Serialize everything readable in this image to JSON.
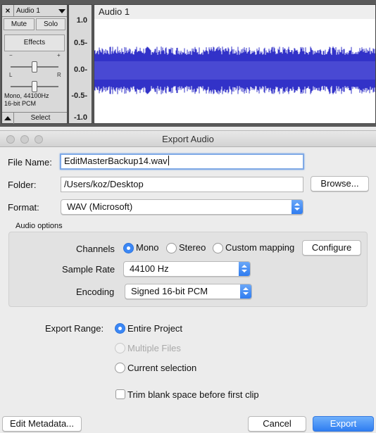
{
  "track": {
    "name": "Audio 1",
    "close_glyph": "×",
    "mute_label": "Mute",
    "solo_label": "Solo",
    "effects_label": "Effects",
    "gain_minus": "−",
    "gain_plus": "+",
    "pan_left": "L",
    "pan_right": "R",
    "info_line1": "Mono, 44100Hz",
    "info_line2": "16-bit PCM",
    "select_label": "Select",
    "waveform_title": "Audio 1",
    "ruler_labels": [
      "1.0",
      "0.5-",
      "0.0-",
      "-0.5-",
      "-1.0"
    ],
    "wave_color": "#3232c8"
  },
  "dialog": {
    "title": "Export Audio",
    "file_name_label": "File Name:",
    "file_name_value": "EditMasterBackup14.wav",
    "folder_label": "Folder:",
    "folder_value": "/Users/koz/Desktop",
    "browse_label": "Browse...",
    "format_label": "Format:",
    "format_value": "WAV (Microsoft)",
    "audio_options_label": "Audio options",
    "channels_label": "Channels",
    "channel_mono": "Mono",
    "channel_stereo": "Stereo",
    "channel_custom": "Custom mapping",
    "configure_label": "Configure",
    "sample_rate_label": "Sample Rate",
    "sample_rate_value": "44100 Hz",
    "encoding_label": "Encoding",
    "encoding_value": "Signed 16-bit PCM",
    "export_range_label": "Export Range:",
    "range_entire": "Entire Project",
    "range_multiple": "Multiple Files",
    "range_current": "Current selection",
    "trim_label": "Trim blank space before first clip",
    "edit_metadata_label": "Edit Metadata...",
    "cancel_label": "Cancel",
    "export_label": "Export",
    "accent_color": "#3b87f5"
  }
}
